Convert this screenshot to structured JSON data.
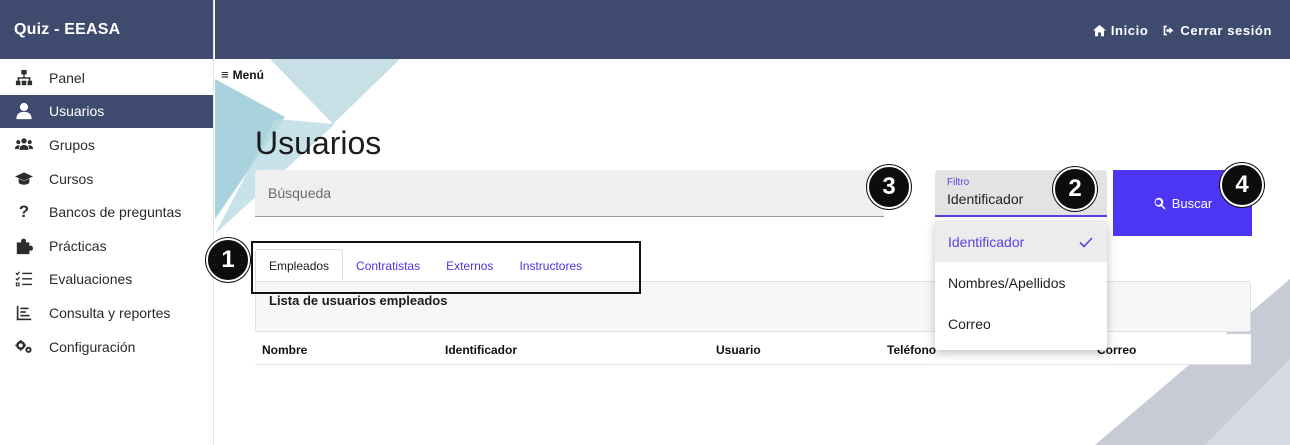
{
  "app": {
    "title": "Quiz - EEASA"
  },
  "colors": {
    "navbar": "#3f4b6e",
    "accent": "#5b3fe0",
    "button": "#4d35f4",
    "deco_teal": "#a8d3dc",
    "deco_gray": "#c6cbd5"
  },
  "topbar": {
    "home": {
      "label": "Inicio",
      "icon": "home-icon"
    },
    "logout": {
      "label": "Cerrar sesión",
      "icon": "sign-out-icon"
    }
  },
  "sidebar": {
    "items": [
      {
        "label": "Panel",
        "icon": "sitemap-icon",
        "active": false
      },
      {
        "label": "Usuarios",
        "icon": "user-icon",
        "active": true
      },
      {
        "label": "Grupos",
        "icon": "users-icon",
        "active": false
      },
      {
        "label": "Cursos",
        "icon": "graduation-cap-icon",
        "active": false
      },
      {
        "label": "Bancos de preguntas",
        "icon": "question-icon",
        "active": false
      },
      {
        "label": "Prácticas",
        "icon": "puzzle-icon",
        "active": false
      },
      {
        "label": "Evaluaciones",
        "icon": "checklist-icon",
        "active": false
      },
      {
        "label": "Consulta y reportes",
        "icon": "report-icon",
        "active": false
      },
      {
        "label": "Configuración",
        "icon": "cogs-icon",
        "active": false
      }
    ]
  },
  "main": {
    "menu_toggle": {
      "icon": "≡",
      "label": "Menú"
    },
    "title": "Usuarios",
    "search": {
      "placeholder": "Búsqueda",
      "value": ""
    },
    "filter": {
      "label": "Filtro",
      "value": "Identificador",
      "options": [
        {
          "label": "Identificador",
          "selected": true
        },
        {
          "label": "Nombres/Apellidos",
          "selected": false
        },
        {
          "label": "Correo",
          "selected": false
        }
      ]
    },
    "search_button": {
      "label": "Buscar",
      "icon": "search-icon"
    },
    "tabs": [
      {
        "label": "Empleados",
        "active": true
      },
      {
        "label": "Contratistas",
        "active": false
      },
      {
        "label": "Externos",
        "active": false
      },
      {
        "label": "Instructores",
        "active": false
      }
    ],
    "panel_title": "Lista de usuarios empleados",
    "table": {
      "columns": [
        "Nombre",
        "Identificador",
        "Usuario",
        "Teléfono",
        "Correo"
      ]
    }
  },
  "callouts": [
    "1",
    "2",
    "3",
    "4"
  ]
}
